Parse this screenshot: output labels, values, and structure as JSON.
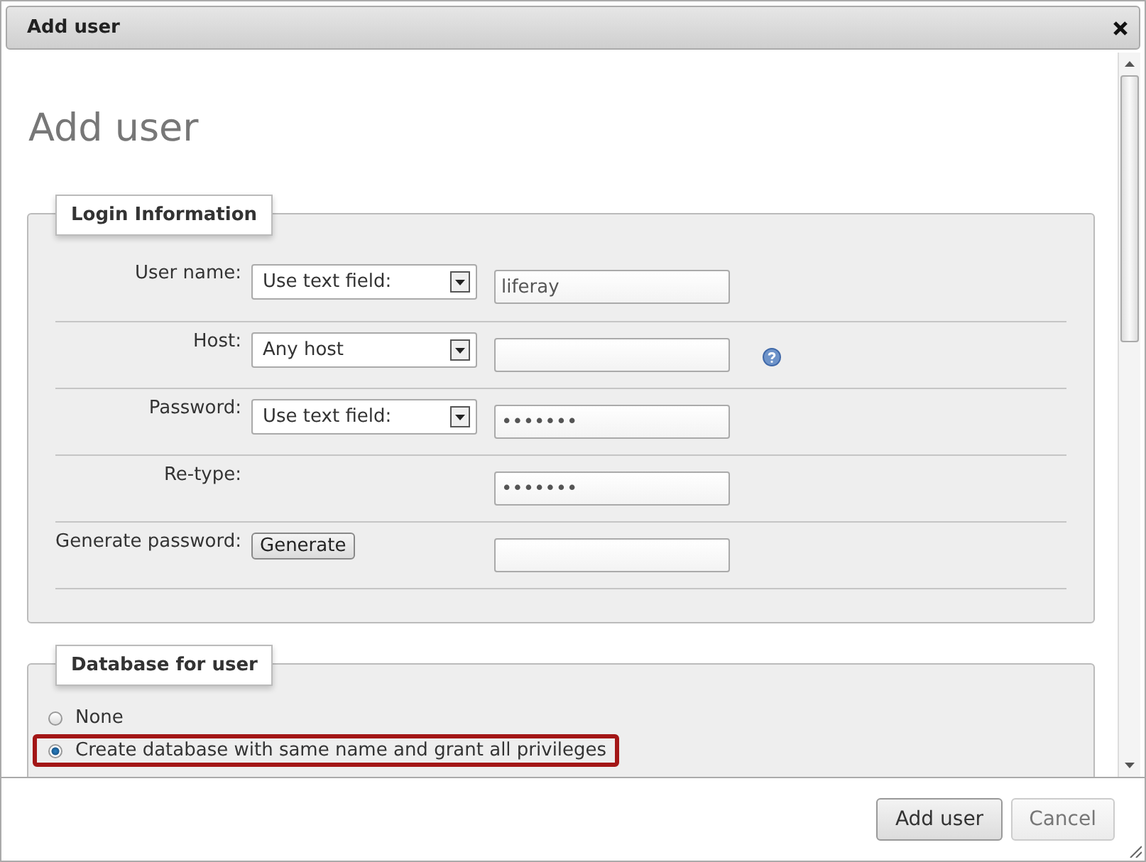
{
  "window": {
    "title": "Add user"
  },
  "heading": "Add user",
  "login_information": {
    "legend": "Login Information",
    "rows": [
      {
        "kind": "select",
        "label": "User name:",
        "select": "Use text field:",
        "value": "liferay",
        "help": false
      },
      {
        "kind": "select",
        "label": "Host:",
        "select": "Any host",
        "help": true
      },
      {
        "kind": "select",
        "label": "Password:",
        "select": "Use text field:",
        "value": "•••••••",
        "help": false
      },
      {
        "kind": "plain",
        "label": "Re-type:",
        "value": "•••••••",
        "help": false
      },
      {
        "kind": "button",
        "label": "Generate password:",
        "button": "Generate",
        "help": false
      }
    ]
  },
  "database_for_user": {
    "legend": "Database for user",
    "options": [
      {
        "label": "None",
        "selected": false,
        "highlighted": false
      },
      {
        "label": "Create database with same name and grant all privileges",
        "selected": true,
        "highlighted": true
      }
    ]
  },
  "buttons": [
    {
      "label": "Add user",
      "focused": true
    },
    {
      "label": "Cancel",
      "focused": false
    }
  ]
}
